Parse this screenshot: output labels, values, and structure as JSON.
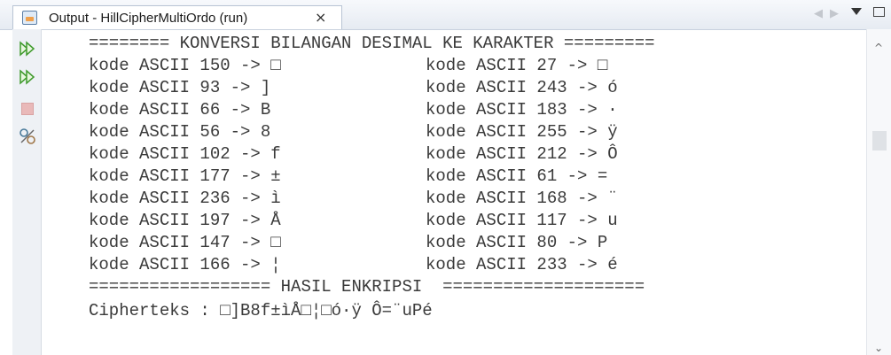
{
  "tab": {
    "title": "Output - HillCipherMultiOrdo (run)",
    "close_glyph": "×"
  },
  "nav": {
    "left_glyph": "◀",
    "right_glyph": "▶"
  },
  "side_icons": [
    "rerun-icon",
    "rerun-icon",
    "stop-icon",
    "settings-icon"
  ],
  "console": {
    "header": "======== KONVERSI BILANGAN DESIMAL KE KARAKTER =========",
    "left_lines": [
      "kode ASCII 150 -> □",
      "kode ASCII 93 -> ]",
      "kode ASCII 66 -> B",
      "kode ASCII 56 -> 8",
      "kode ASCII 102 -> f",
      "kode ASCII 177 -> ±",
      "kode ASCII 236 -> ì",
      "kode ASCII 197 -> Å",
      "kode ASCII 147 -> □",
      "kode ASCII 166 -> ¦"
    ],
    "right_lines": [
      "kode ASCII 27 -> □",
      "kode ASCII 243 -> ó",
      "kode ASCII 183 -> ·",
      "kode ASCII 255 -> ÿ",
      "kode ASCII 212 -> Ô",
      "kode ASCII 61 -> =",
      "kode ASCII 168 -> ¨",
      "kode ASCII 117 -> u",
      "kode ASCII 80 -> P",
      "kode ASCII 233 -> é"
    ],
    "footer": "================== HASIL ENKRIPSI  ====================",
    "cipher": "Cipherteks : □]B8f±ìÅ□¦□ó·ÿ Ô=¨uPé"
  },
  "scroll": {
    "up_glyph": "^",
    "down_glyph": "⌄"
  }
}
